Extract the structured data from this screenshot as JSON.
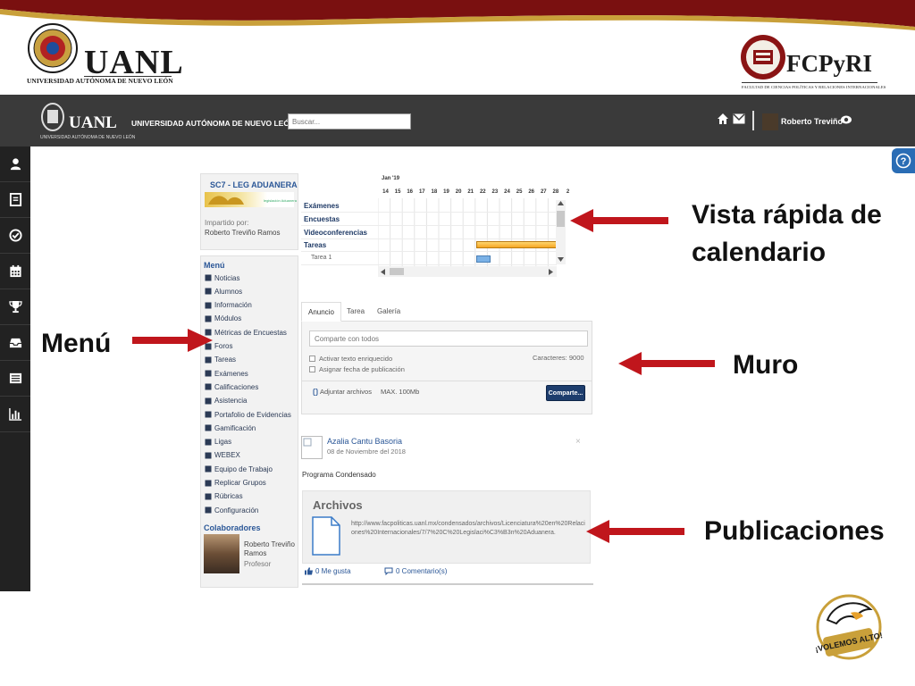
{
  "slide": {
    "uanl_logo": {
      "word": "UANL",
      "subtitle": "UNIVERSIDAD AUTÓNOMA DE NUEVO LEÓN"
    },
    "fcp_logo": {
      "word": "FCPyRI",
      "subtitle": "FACULTAD DE CIENCIAS POLÍTICAS Y RELACIONES INTERNACIONALES"
    },
    "annotations": {
      "calendar": "Vista rápida de calendario",
      "menu": "Menú",
      "wall": "Muro",
      "posts": "Publicaciones"
    },
    "mascot_text": "¡VOLEMOS ALTO!"
  },
  "topbar": {
    "logo_word": "UANL",
    "logo_sub": "UNIVERSIDAD AUTÓNOMA DE NUEVO LEÓN",
    "title": "UNIVERSIDAD AUTÓNOMA DE NUEVO LEÓN",
    "search_placeholder": "Buscar...",
    "user_name": "Roberto Treviño"
  },
  "sidebar": {
    "items": [
      "user-icon",
      "notebook-icon",
      "check-circle-icon",
      "calendar-icon",
      "trophy-icon",
      "inbox-icon",
      "list-icon",
      "bar-chart-icon"
    ]
  },
  "course": {
    "title": "SC7 - LEG ADUANERA",
    "image_caption": "legislación Aduanera",
    "taught_by_label": "Impartido por:",
    "teacher": "Roberto Treviño Ramos"
  },
  "menu": {
    "title": "Menú",
    "items": [
      {
        "label": "Noticias",
        "icon": "news-icon"
      },
      {
        "label": "Alumnos",
        "icon": "students-icon"
      },
      {
        "label": "Información",
        "icon": "info-icon"
      },
      {
        "label": "Módulos",
        "icon": "modules-icon"
      },
      {
        "label": "Métricas de Encuestas",
        "icon": "metrics-icon"
      },
      {
        "label": "Foros",
        "icon": "forum-icon"
      },
      {
        "label": "Tareas",
        "icon": "tasks-icon"
      },
      {
        "label": "Exámenes",
        "icon": "exams-icon"
      },
      {
        "label": "Calificaciones",
        "icon": "grades-icon"
      },
      {
        "label": "Asistencia",
        "icon": "attendance-icon"
      },
      {
        "label": "Portafolio de Evidencias",
        "icon": "portfolio-icon"
      },
      {
        "label": "Gamificación",
        "icon": "gamification-icon"
      },
      {
        "label": "Ligas",
        "icon": "links-icon"
      },
      {
        "label": "WEBEX",
        "icon": "webex-icon"
      },
      {
        "label": "Equipo de Trabajo",
        "icon": "team-icon"
      },
      {
        "label": "Replicar Grupos",
        "icon": "replicate-icon"
      },
      {
        "label": "Rúbricas",
        "icon": "rubrics-icon"
      },
      {
        "label": "Configuración",
        "icon": "settings-icon"
      }
    ],
    "collaborators_title": "Colaboradores",
    "collaborator_name": "Roberto Treviño Ramos",
    "collaborator_role": "Profesor"
  },
  "calendar": {
    "month": "Jan '19",
    "days": [
      "14",
      "15",
      "16",
      "17",
      "18",
      "19",
      "20",
      "21",
      "22",
      "23",
      "24",
      "25",
      "26",
      "27",
      "28",
      "2"
    ],
    "rows": [
      {
        "label": "Exámenes",
        "kind": "header"
      },
      {
        "label": "Encuestas",
        "kind": "header"
      },
      {
        "label": "Videoconferencias",
        "kind": "header"
      },
      {
        "label": "Tareas",
        "kind": "header"
      },
      {
        "label": "Tarea 1",
        "kind": "sub"
      }
    ]
  },
  "wall": {
    "tabs": [
      "Anuncio",
      "Tarea",
      "Galería"
    ],
    "active_tab": "Anuncio",
    "input_placeholder": "Comparte con todos",
    "rich_text_label": "Activar texto enriquecido",
    "publish_date_label": "Asignar fecha de publicación",
    "chars_label": "Caracteres:",
    "chars_value": "9000",
    "attach_label": "Adjuntar archivos",
    "max_size": "MAX. 100Mb",
    "share_button": "Comparte..."
  },
  "post": {
    "author": "Azalia Cantu Basoria",
    "date": "08 de Noviembre del 2018",
    "close": "×",
    "text": "Programa Condensado",
    "files_title": "Archivos",
    "file_link": "http://www.facpoliticas.uanl.mx/condensados/archivos/Licenciatura%20en%20Relaciones%20Internacionales/7/7%20C%20Legislaci%C3%B3n%20Aduanera.",
    "likes": "0 Me gusta",
    "comments": "0 Comentario(s)"
  },
  "colors": {
    "topbar": "#3a3a3a",
    "sidebar": "#222222",
    "link_blue": "#2b5797",
    "arrow_red": "#c0161c",
    "share_button": "#1d3d6d",
    "task_bar": "#f5a623"
  }
}
